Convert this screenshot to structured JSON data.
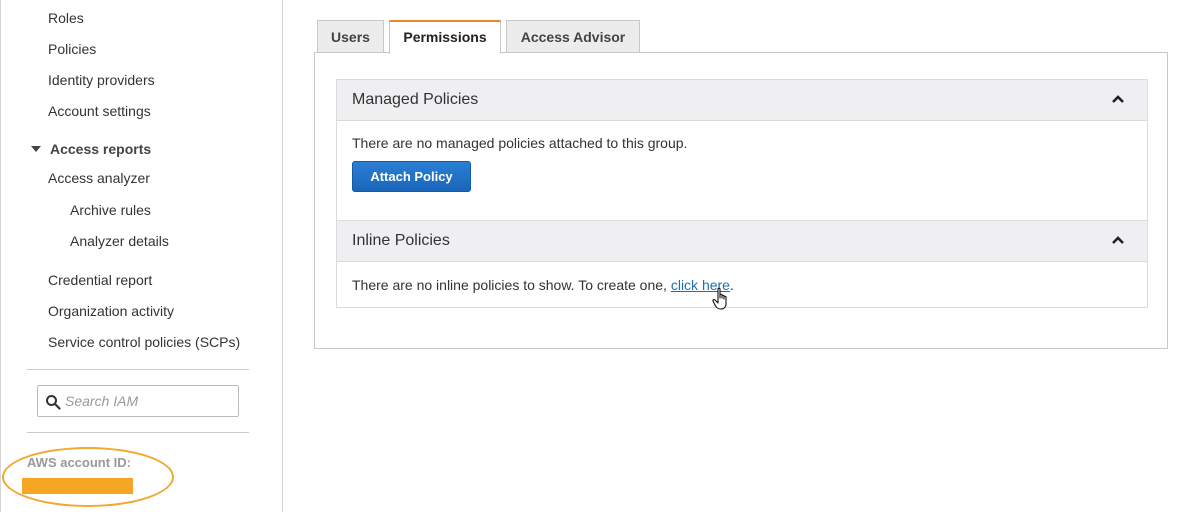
{
  "sidebar": {
    "items": [
      {
        "label": "Roles"
      },
      {
        "label": "Policies"
      },
      {
        "label": "Identity providers"
      },
      {
        "label": "Account settings"
      }
    ],
    "access_reports": {
      "label": "Access reports",
      "items": [
        {
          "label": "Access analyzer"
        },
        {
          "label": "Archive rules"
        },
        {
          "label": "Analyzer details"
        },
        {
          "label": "Credential report"
        },
        {
          "label": "Organization activity"
        },
        {
          "label": "Service control policies (SCPs)"
        }
      ]
    },
    "search": {
      "placeholder": "Search IAM",
      "value": ""
    },
    "account_id_label": "AWS account ID:",
    "highlight_color": "#f0a830"
  },
  "tabs": [
    {
      "label": "Users",
      "active": false
    },
    {
      "label": "Permissions",
      "active": true
    },
    {
      "label": "Access Advisor",
      "active": false
    }
  ],
  "managed_policies": {
    "title": "Managed Policies",
    "message": "There are no managed policies attached to this group.",
    "attach_button": "Attach Policy"
  },
  "inline_policies": {
    "title": "Inline Policies",
    "message": "There are no inline policies to show. To create one,",
    "link": "click here",
    "suffix": "."
  },
  "colors": {
    "accent_tab": "#e8862a",
    "primary_button": "#1a66b9",
    "link": "#1a6fb5"
  }
}
